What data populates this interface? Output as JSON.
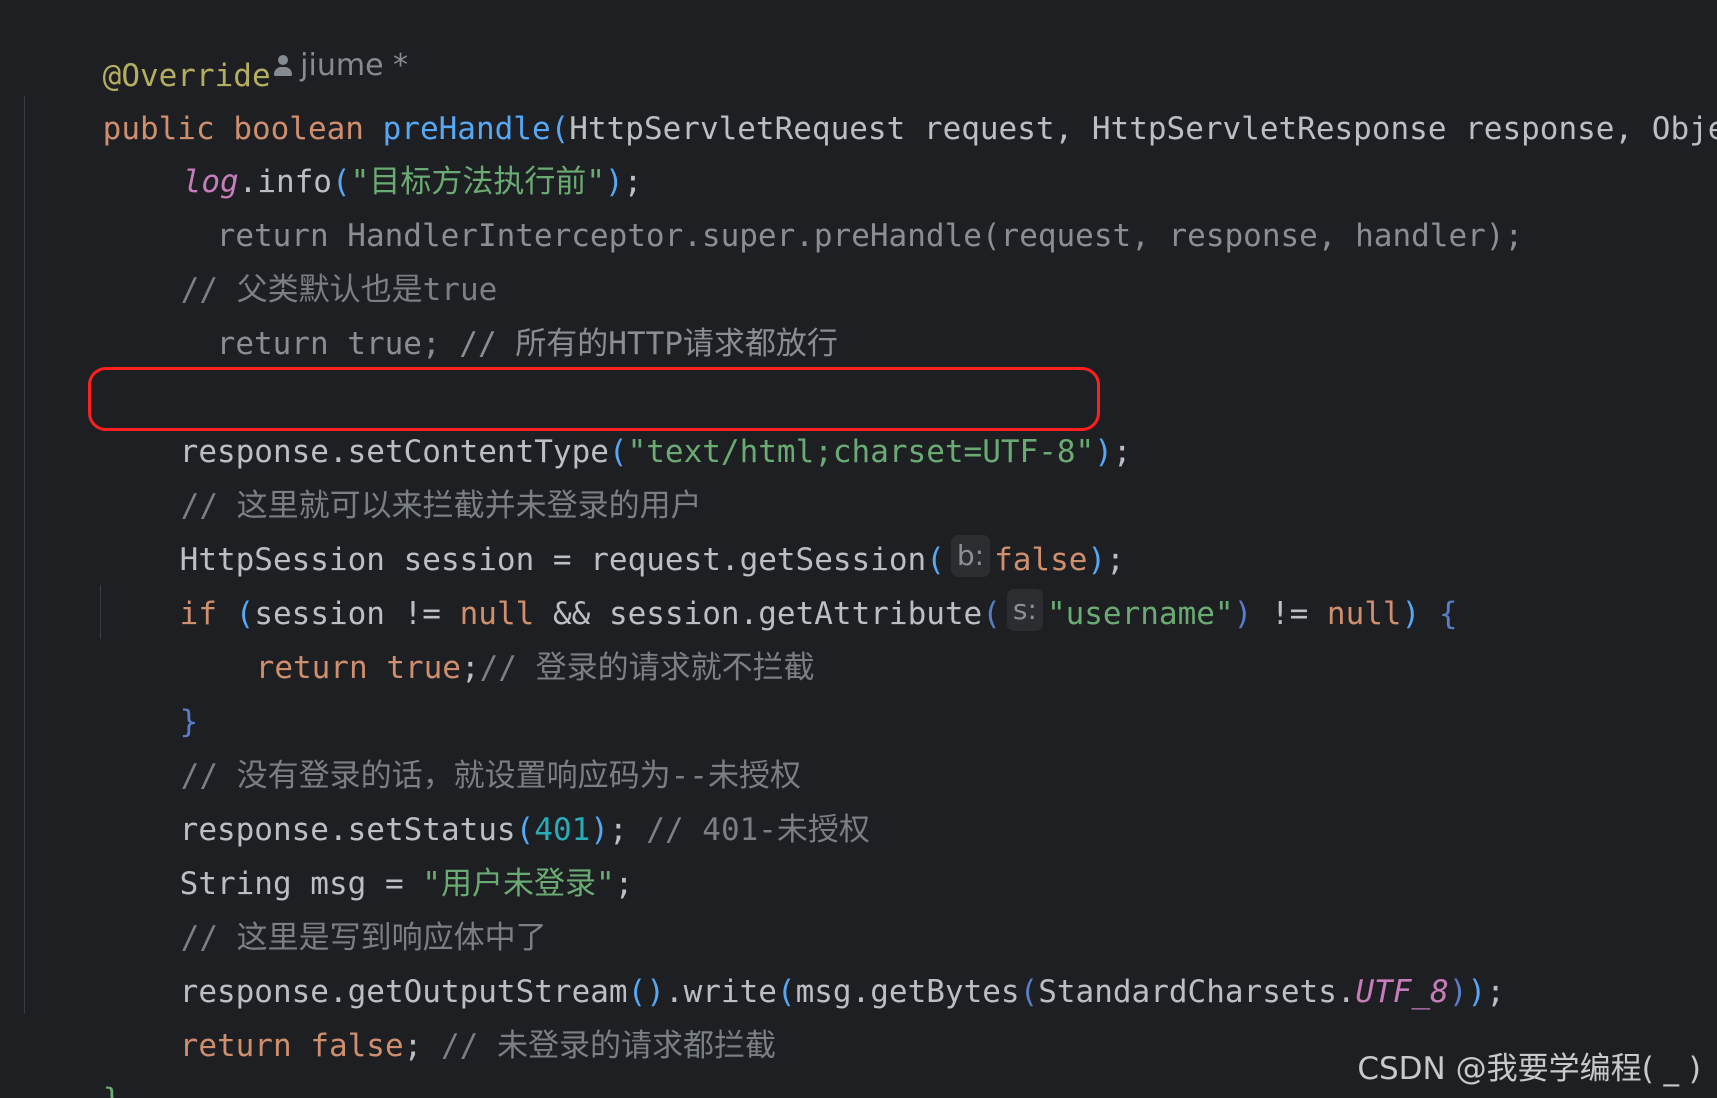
{
  "editor": {
    "author": "jiume *",
    "lines": [
      {
        "annotation": "@Override"
      },
      {
        "kw_public": "public",
        "kw_boolean": "boolean",
        "method": "preHandle",
        "open": "(",
        "text": "HttpServletRequest request, HttpServletResponse response, Object"
      },
      {
        "field": "log",
        "dot_info": ".info",
        "open": "(",
        "string": "\"目标方法执行前\"",
        "close": ")",
        "semi": ";"
      },
      {
        "text": "return HandlerInterceptor.super.preHandle(request, response, handler);"
      },
      {
        "text": "// 父类默认也是true"
      },
      {
        "text": "return true; // 所有的HTTP请求都放行"
      },
      {
        "receiver": "response.setContentType",
        "open": "(",
        "string": "\"text/html;charset=UTF-8\"",
        "close": ")",
        "semi": ";"
      },
      {
        "comment": "// 这里就可以来拦截并未登录的用户"
      },
      {
        "before": "HttpSession session = request.getSession",
        "open": "(",
        "hint": "b:",
        "value": "false",
        "close": ")",
        "semi": ";"
      },
      {
        "kw_if": "if",
        "open": "(",
        "part1": "session != ",
        "null1": "null",
        "part2": " && session.getAttribute",
        "open2": "(",
        "hint": "s:",
        "string": "\"username\"",
        "close2": ")",
        "part3": " != ",
        "null2": "null",
        "close": ")",
        "brace": " {"
      },
      {
        "kw_return": "return",
        "kw_true": "true",
        "semi": ";",
        "comment": "// 登录的请求就不拦截"
      },
      {
        "brace": "}"
      },
      {
        "comment": "// 没有登录的话，就设置响应码为--未授权"
      },
      {
        "receiver": "response.setStatus",
        "open": "(",
        "number": "401",
        "close": ")",
        "semi": ";",
        "comment": " // 401-未授权"
      },
      {
        "before": "String msg = ",
        "string": "\"用户未登录\"",
        "semi": ";"
      },
      {
        "comment": "// 这里是写到响应体中了"
      },
      {
        "receiver": "response.getOutputStream",
        "open1": "(",
        "close1": ")",
        "write": ".write",
        "open2": "(",
        "mid": "msg.getBytes",
        "open3": "(",
        "cls": "StandardCharsets.",
        "constant": "UTF_8",
        "close3": ")",
        "close2": ")",
        "semi": ";"
      },
      {
        "kw_return": "return",
        "kw_false": "false",
        "semi": ";",
        "comment": " // 未登录的请求都拦截"
      },
      {
        "brace": "}"
      }
    ]
  },
  "watermark": "CSDN @我要学编程( _ )"
}
